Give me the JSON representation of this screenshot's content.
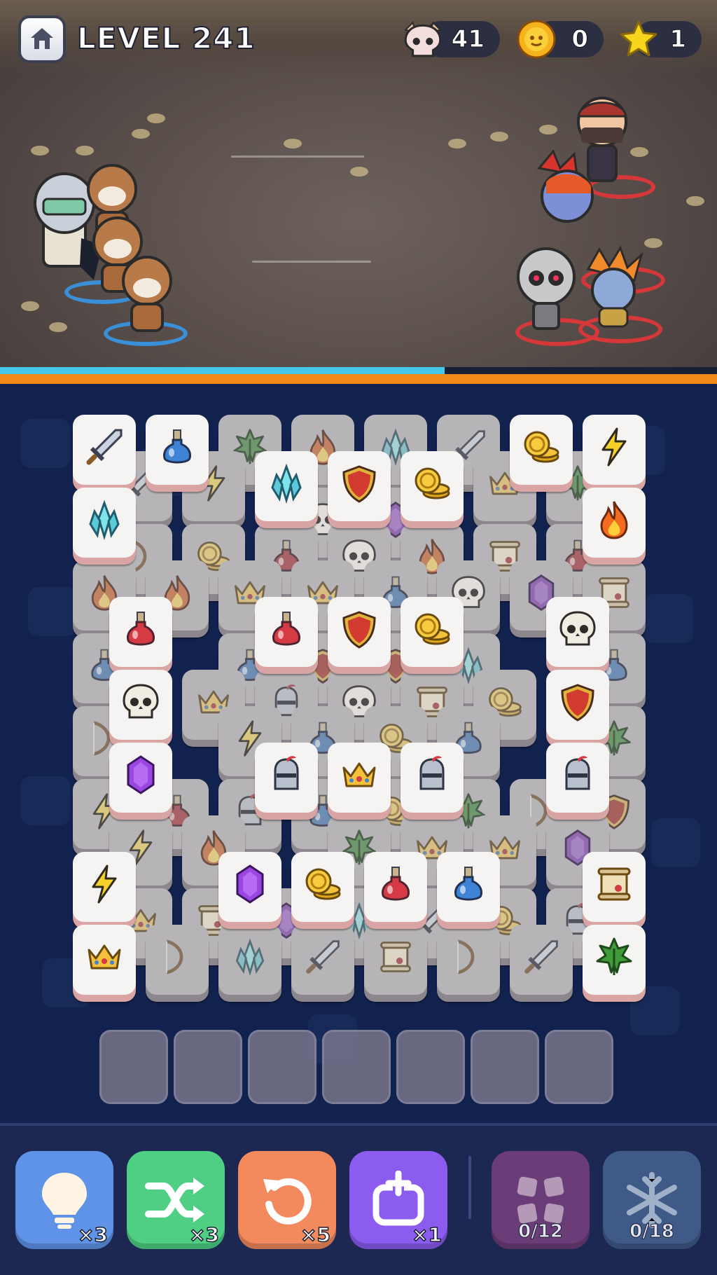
{
  "header": {
    "level_label": "LEVEL 241",
    "skulls": "41",
    "coins": "0",
    "stars": "1"
  },
  "battle": {
    "player_hp_percent": 62,
    "colors": {
      "hp": "#45c8e8",
      "enemy_bar": "#f08a1a"
    }
  },
  "board": {
    "slots_total": 7,
    "slots_filled": 0
  },
  "tools": [
    {
      "name": "hint",
      "icon": "lightbulb-icon",
      "count": "×3",
      "color": "#5f93e8"
    },
    {
      "name": "shuffle",
      "icon": "shuffle-icon",
      "count": "×3",
      "color": "#4fcf84"
    },
    {
      "name": "undo",
      "icon": "undo-icon",
      "count": "×5",
      "color": "#f28a5e"
    },
    {
      "name": "add-slot",
      "icon": "add-slot-icon",
      "count": "×1",
      "color": "#8c5cf0"
    },
    {
      "name": "merge",
      "icon": "merge-icon",
      "progress": "0/12",
      "color": "#6a3c78"
    },
    {
      "name": "freeze",
      "icon": "snowflake-icon",
      "progress": "0/18",
      "color": "#3f5a86"
    }
  ]
}
